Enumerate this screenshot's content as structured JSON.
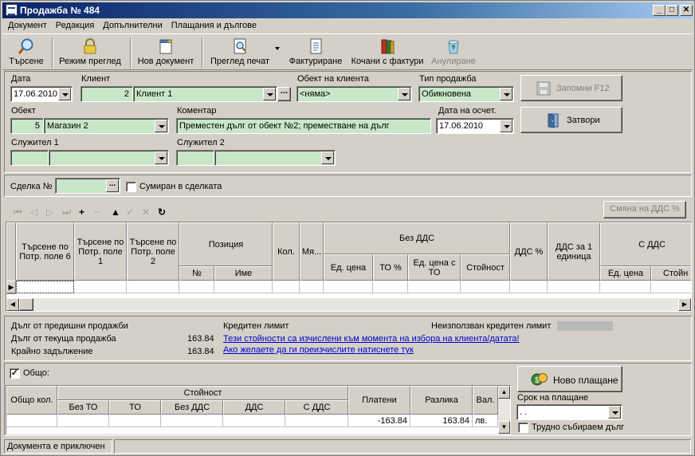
{
  "window": {
    "title": "Продажба № 484"
  },
  "menu": [
    "Документ",
    "Редакция",
    "Допълнителни",
    "Плащания и дългове"
  ],
  "toolbar": {
    "search": "Търсене",
    "view_mode": "Режим преглед",
    "new_doc": "Нов документ",
    "print_preview": "Преглед печат",
    "invoicing": "Фактуриране",
    "invoice_bags": "Кочани с фактури",
    "cancel": "Анулиране"
  },
  "form": {
    "date_label": "Дата",
    "date_value": "17.06.2010",
    "client_label": "Клиент",
    "client_id": "2",
    "client_name": "Клиент 1",
    "client_object_label": "Обект на клиента",
    "client_object_value": "<няма>",
    "sale_type_label": "Тип продажба",
    "sale_type_value": "Обикновена",
    "object_label": "Обект",
    "object_id": "5",
    "object_name": "Магазин 2",
    "comment_label": "Коментар",
    "comment_value": "Преместен дълг от обект №2; преместване на дълг",
    "accounting_date_label": "Дата на осчет.",
    "accounting_date_value": "17.06.2010",
    "employee1_label": "Служител 1",
    "employee2_label": "Служител 2",
    "save_button": "Запомни  F12",
    "close_button": "Затвори"
  },
  "deal": {
    "label": "Сделка №",
    "summed_label": "Сумиран в сделката",
    "vat_change_button": "Смяна на ДДС %"
  },
  "items_grid": {
    "headers": {
      "search6": "Търсене по Потр. поле 6",
      "search1": "Търсене по Потр. поле 1",
      "search2": "Търсене по Потр. поле 2",
      "position": "Позиция",
      "position_no": "№",
      "position_name": "Име",
      "qty": "Кол.",
      "unit": "Мя...",
      "without_vat": "Без ДДС",
      "unit_price": "Ед. цена",
      "to_pct": "ТО %",
      "unit_price_to": "Ед. цена с ТО",
      "value": "Стойност",
      "vat_pct": "ДДС %",
      "vat_per_unit": "ДДС за 1 единица",
      "with_vat": "С ДДС",
      "unit_price2": "Ед. цена",
      "value2": "Стойн"
    }
  },
  "debt": {
    "prev_sales_label": "Дълг от предишни продажби",
    "current_sale_label": "Дълг от текуща продажба",
    "current_sale_value": "163.84",
    "final_label": "Крайно задължение",
    "final_value": "163.84",
    "credit_limit_label": "Кредитен лимит",
    "unused_credit_label": "Неизползван кредитен лимит",
    "link1": "Тези стойности са изчислени към момента на избора на клиента/датата!",
    "link2": "Ако желаете да ги преизчислите натиснете тук"
  },
  "totals": {
    "total_label": "Общо:",
    "headers": {
      "total_qty": "Общо кол.",
      "value": "Стойност",
      "without_to": "Без ТО",
      "to": "ТО",
      "without_vat": "Без ДДС",
      "vat": "ДДС",
      "with_vat": "С ДДС",
      "paid": "Платени",
      "difference": "Разлика",
      "currency": "Вал."
    },
    "row": {
      "paid": "-163.84",
      "difference": "163.84",
      "currency": "лв."
    },
    "new_payment_button": "Ново плащане",
    "payment_term_label": "Срок на плащане",
    "payment_term_value": " .  .",
    "hard_debt_label": "Трудно събираем дълг"
  },
  "status": {
    "text": "Документа е приключен"
  }
}
